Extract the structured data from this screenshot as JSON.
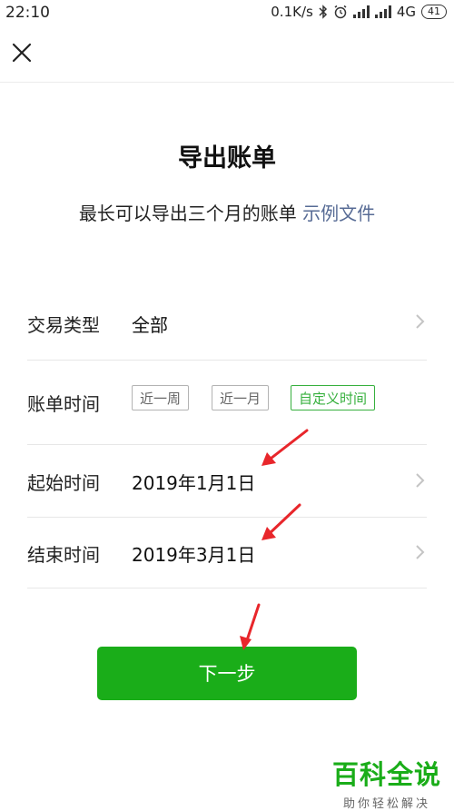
{
  "statusbar": {
    "time": "22:10",
    "speed": "0.1K/s",
    "network": "4G",
    "battery": "41",
    "icons": [
      "bluetooth-icon",
      "alarm-icon",
      "signal-icon",
      "signal-icon"
    ]
  },
  "header": {
    "close_icon": "close-icon"
  },
  "page": {
    "title": "导出账单",
    "subtitle": "最长可以导出三个月的账单",
    "subtitle_link": "示例文件"
  },
  "form": {
    "type_label": "交易类型",
    "type_value": "全部",
    "time_label": "账单时间",
    "time_options": [
      "近一周",
      "近一月",
      "自定义时间"
    ],
    "time_selected": "自定义时间",
    "start_label": "起始时间",
    "start_value": "2019年1月1日",
    "end_label": "结束时间",
    "end_value": "2019年3月1日"
  },
  "actions": {
    "next_label": "下一步"
  },
  "colors": {
    "primary": "#1aad19",
    "link": "#576b95",
    "annotation_red": "#e8262b"
  },
  "watermark": {
    "main": "百科全说",
    "sub": "助你轻松解决"
  }
}
